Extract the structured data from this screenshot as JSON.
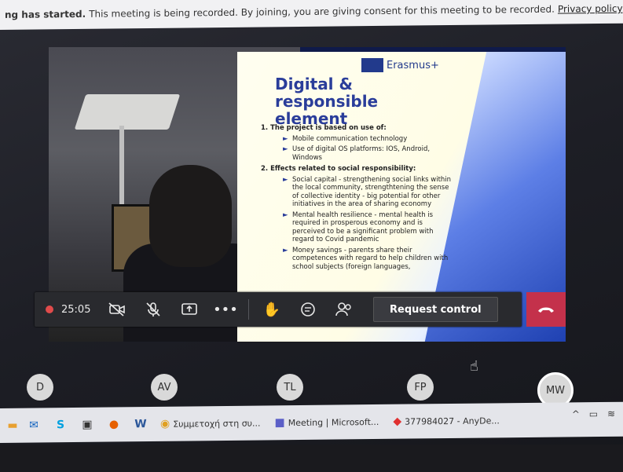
{
  "banner": {
    "bold": "ng has started.",
    "message": "This meeting is being recorded. By joining, you are giving consent for this meeting to be recorded.",
    "link": "Privacy policy"
  },
  "slide": {
    "logo": "Erasmus+",
    "title_line1": "Digital & responsible",
    "title_line2": "element",
    "heading1": "1. The project is based on use of:",
    "items1": [
      "Mobile communication technology",
      "Use of digital OS platforms: IOS, Android, Windows"
    ],
    "heading2": "2. Effects related to social responsibility:",
    "items2": [
      "Social capital - strengthening social links within the local community, strengthtening the sense of collective identity - big potential for other initiatives in the area of sharing economy",
      "Mental health resilience - mental health is required in prosperous economy and is perceived to be a significant problem with regard to Covid pandemic",
      "Money savings - parents share their competences with regard to help children with school subjects (foreign languages,"
    ]
  },
  "toolbar": {
    "timer": "25:05",
    "request_control": "Request control",
    "icons": [
      "camera-off-icon",
      "mic-off-icon",
      "share-screen-icon",
      "more-icon",
      "raise-hand-icon",
      "chat-icon",
      "participants-icon",
      "hang-up-icon"
    ]
  },
  "participants": [
    {
      "initials": "D",
      "color": "#d9d9d9"
    },
    {
      "initials": "AV",
      "color": "#d9d9d9"
    },
    {
      "initials": "TL",
      "color": "#d9d9d9"
    },
    {
      "initials": "FP",
      "color": "#d9d9d9"
    },
    {
      "initials": "MW",
      "color": "#d9d9d9"
    }
  ],
  "taskbar": {
    "chrome_label": "Συμμετοχή στη συ...",
    "teams_label": "Meeting | Microsoft...",
    "anydesk_label": "377984027 - AnyDe..."
  }
}
